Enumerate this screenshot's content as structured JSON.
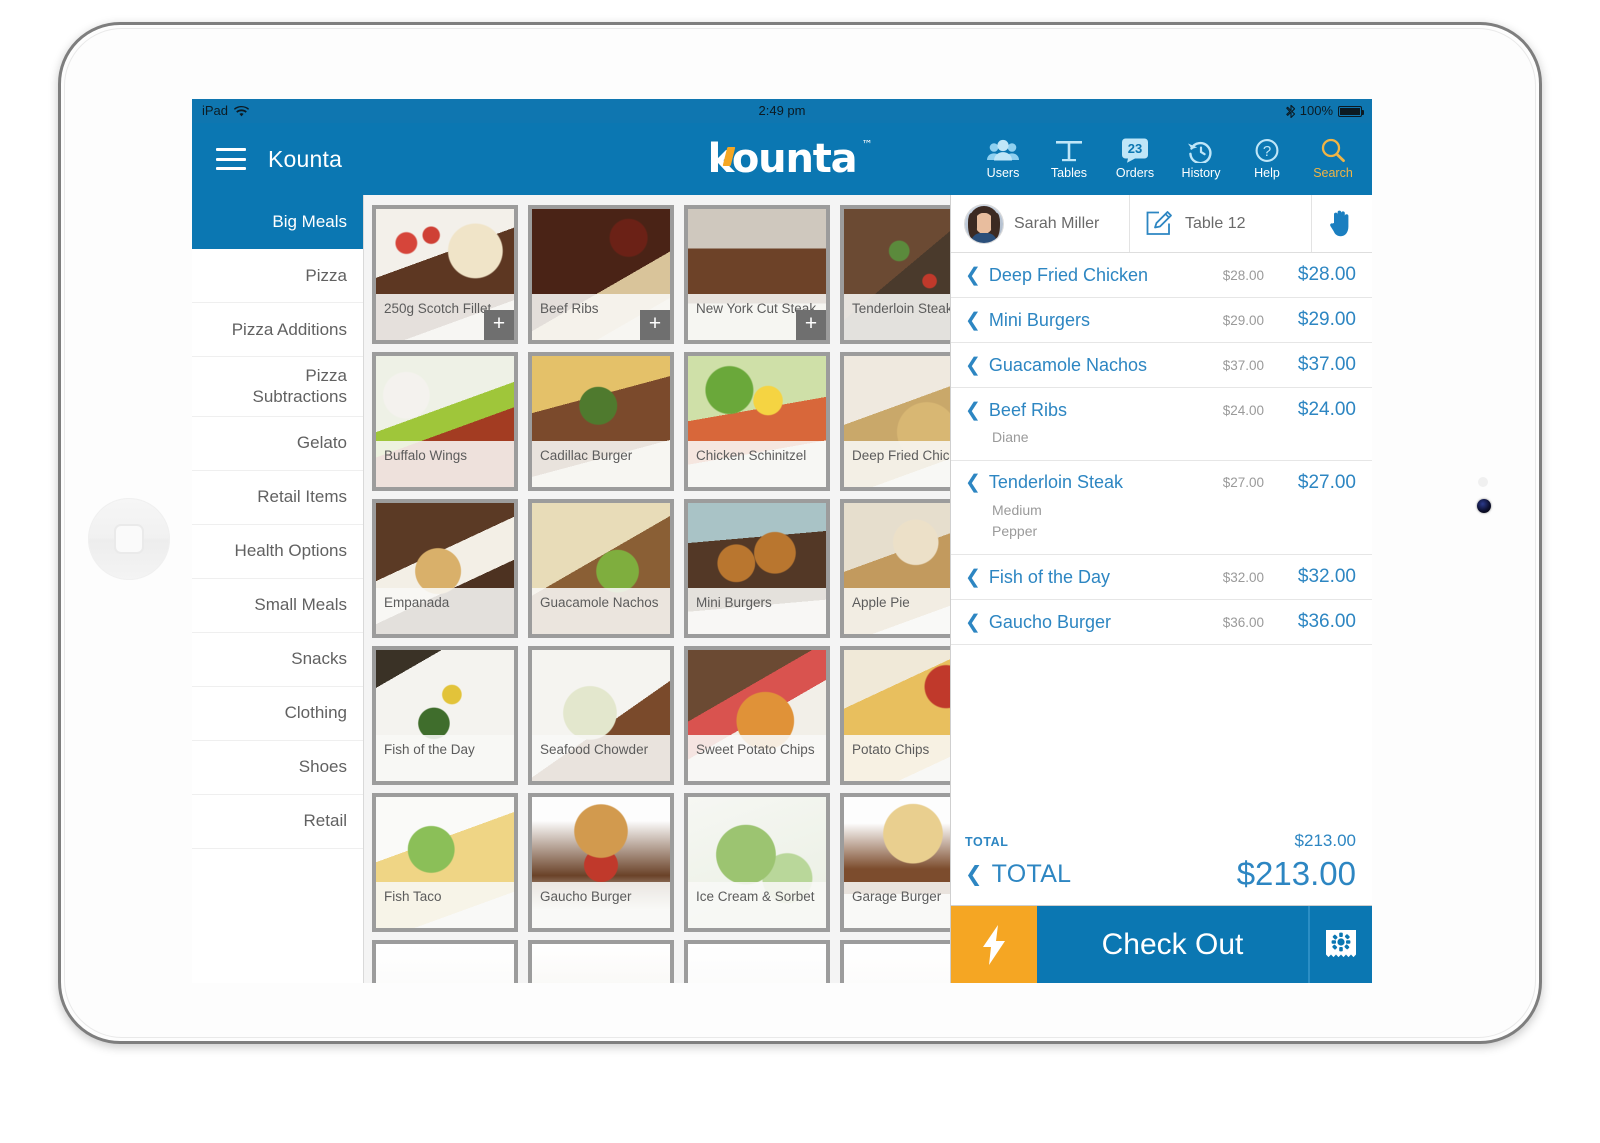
{
  "status_bar": {
    "device": "iPad",
    "wifi_icon": "wifi-icon",
    "time": "2:49 pm",
    "bluetooth_icon": "bluetooth-icon",
    "battery": "100%"
  },
  "navbar": {
    "menu_icon": "hamburger-icon",
    "title": "Kounta",
    "logo_text": "kounta",
    "logo_tm": "™",
    "tools": [
      {
        "label": "Users",
        "icon": "users-icon"
      },
      {
        "label": "Tables",
        "icon": "table-icon"
      },
      {
        "label": "Orders",
        "icon": "speech-bubble-icon",
        "badge": "23"
      },
      {
        "label": "History",
        "icon": "clock-rewind-icon"
      },
      {
        "label": "Help",
        "icon": "question-mark-icon"
      },
      {
        "label": "Search",
        "icon": "magnifier-icon"
      }
    ]
  },
  "sidebar": {
    "items": [
      {
        "label": "Big Meals",
        "active": true
      },
      {
        "label": "Pizza",
        "active": false
      },
      {
        "label": "Pizza Additions",
        "active": false
      },
      {
        "label": "Pizza Subtractions",
        "active": false
      },
      {
        "label": "Gelato",
        "active": false
      },
      {
        "label": "Retail Items",
        "active": false
      },
      {
        "label": "Health Options",
        "active": false
      },
      {
        "label": "Small Meals",
        "active": false
      },
      {
        "label": "Snacks",
        "active": false
      },
      {
        "label": "Clothing",
        "active": false
      },
      {
        "label": "Shoes",
        "active": false
      },
      {
        "label": "Retail",
        "active": false
      }
    ]
  },
  "products": [
    {
      "name": "250g Scotch Fillet",
      "add_button": "+",
      "img": "steak-fillet"
    },
    {
      "name": "Beef Ribs",
      "add_button": "+",
      "img": "beef-ribs"
    },
    {
      "name": "New York Cut Steak",
      "add_button": "+",
      "img": "ny-steak"
    },
    {
      "name": "Tenderloin Steak",
      "add_button": "+",
      "img": "tenderloin"
    },
    {
      "name": "Buffalo Wings",
      "add_button": "",
      "img": "buffalo-wings"
    },
    {
      "name": "Cadillac Burger",
      "add_button": "",
      "img": "cadillac-burger"
    },
    {
      "name": "Chicken Schinitzel",
      "add_button": "",
      "img": "schnitzel"
    },
    {
      "name": "Deep Fried Chicken",
      "add_button": "",
      "img": "fried-chicken"
    },
    {
      "name": "Empanada",
      "add_button": "",
      "img": "empanada"
    },
    {
      "name": "Guacamole Nachos",
      "add_button": "",
      "img": "nachos"
    },
    {
      "name": "Mini Burgers",
      "add_button": "",
      "img": "mini-burgers"
    },
    {
      "name": "Apple Pie",
      "add_button": "",
      "img": "apple-pie"
    },
    {
      "name": "Fish of the Day",
      "add_button": "",
      "img": "fish-day"
    },
    {
      "name": "Seafood Chowder",
      "add_button": "",
      "img": "chowder"
    },
    {
      "name": "Sweet Potato Chips",
      "add_button": "",
      "img": "sweet-potato"
    },
    {
      "name": "Potato Chips",
      "add_button": "",
      "img": "potato-chips"
    },
    {
      "name": "Fish Taco",
      "add_button": "",
      "img": "fish-taco"
    },
    {
      "name": "Gaucho Burger",
      "add_button": "",
      "img": "gaucho-burger"
    },
    {
      "name": "Ice Cream & Sorbet",
      "add_button": "",
      "img": "gelato"
    },
    {
      "name": "Garage Burger",
      "add_button": "",
      "img": "garage-burger"
    },
    {
      "name": "",
      "add_button": "",
      "img": "soft-serve"
    },
    {
      "name": "",
      "add_button": "",
      "img": "grill-plate"
    },
    {
      "name": "",
      "add_button": "",
      "img": "soup-bowl"
    },
    {
      "name": "",
      "add_button": "",
      "img": "cherry-dessert"
    }
  ],
  "order": {
    "user_name": "Sarah Miller",
    "avatar_icon": "user-avatar",
    "table_icon": "pencil-square-icon",
    "table_label": "Table 12",
    "hold_icon": "hand-icon",
    "items": [
      {
        "name": "Deep Fried Chicken",
        "unit_price": "$28.00",
        "line_total": "$28.00",
        "modifiers": []
      },
      {
        "name": "Mini Burgers",
        "unit_price": "$29.00",
        "line_total": "$29.00",
        "modifiers": []
      },
      {
        "name": "Guacamole Nachos",
        "unit_price": "$37.00",
        "line_total": "$37.00",
        "modifiers": []
      },
      {
        "name": "Beef Ribs",
        "unit_price": "$24.00",
        "line_total": "$24.00",
        "modifiers": [
          "Diane"
        ]
      },
      {
        "name": "Tenderloin Steak",
        "unit_price": "$27.00",
        "line_total": "$27.00",
        "modifiers": [
          "Medium",
          "Pepper"
        ]
      },
      {
        "name": "Fish of the Day",
        "unit_price": "$32.00",
        "line_total": "$32.00",
        "modifiers": []
      },
      {
        "name": "Gaucho Burger",
        "unit_price": "$36.00",
        "line_total": "$36.00",
        "modifiers": []
      }
    ],
    "subtotal_label": "TOTAL",
    "subtotal_value": "$213.00",
    "total_label": "TOTAL",
    "total_value": "$213.00",
    "fast_button_icon": "lightning-bolt-icon",
    "checkout_label": "Check Out",
    "receipt_button_icon": "receipt-gear-icon"
  },
  "colors": {
    "brand_blue": "#0b77b2",
    "accent_orange": "#f5a623",
    "link_blue": "#2d86c2",
    "muted_grey": "#9a9a9a"
  }
}
